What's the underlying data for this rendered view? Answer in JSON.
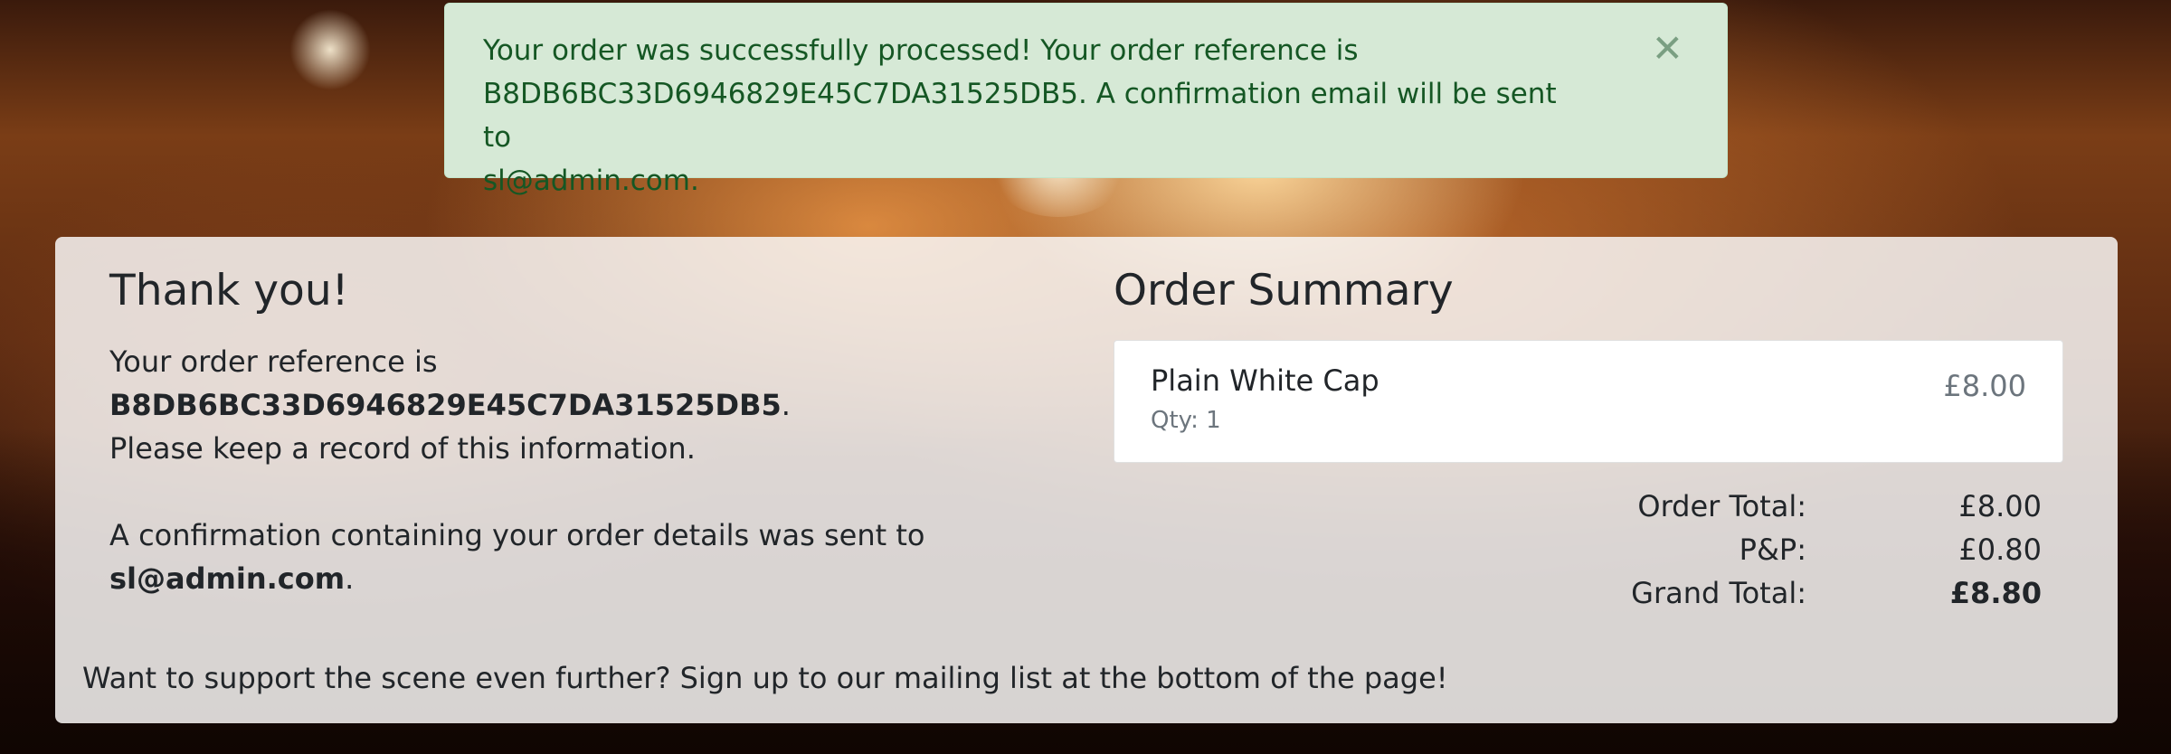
{
  "alert": {
    "message_line1": "Your order was successfully processed! Your order reference is",
    "message_line2": "B8DB6BC33D6946829E45C7DA31525DB5. A confirmation email will be sent to",
    "message_line3": "sl@admin.com.",
    "close_icon": "close-icon",
    "close_glyph": "✕"
  },
  "thank_you": {
    "title": "Thank you!",
    "ref_prefix": "Your order reference is ",
    "ref_value": "B8DB6BC33D6946829E45C7DA31525DB5",
    "ref_suffix": ".",
    "ref_line2": "Please keep a record of this information.",
    "confirm_prefix": "A confirmation containing your order details was sent to",
    "confirm_email": "sl@admin.com",
    "confirm_suffix": "."
  },
  "summary": {
    "title": "Order Summary",
    "items": [
      {
        "name": "Plain White Cap",
        "qty": "Qty: 1",
        "price": "£8.00"
      }
    ],
    "totals": {
      "order_total_label": "Order Total:",
      "order_total_value": "£8.00",
      "pp_label": "P&P:",
      "pp_value": "£0.80",
      "grand_total_label": "Grand Total:",
      "grand_total_value": "£8.80"
    }
  },
  "footer_note": "Want to support the scene even further? Sign up to our mailing list at the bottom of the page!",
  "colors": {
    "alert_bg": "#d6e9d6",
    "alert_text": "#155724",
    "muted": "#6c757d"
  }
}
